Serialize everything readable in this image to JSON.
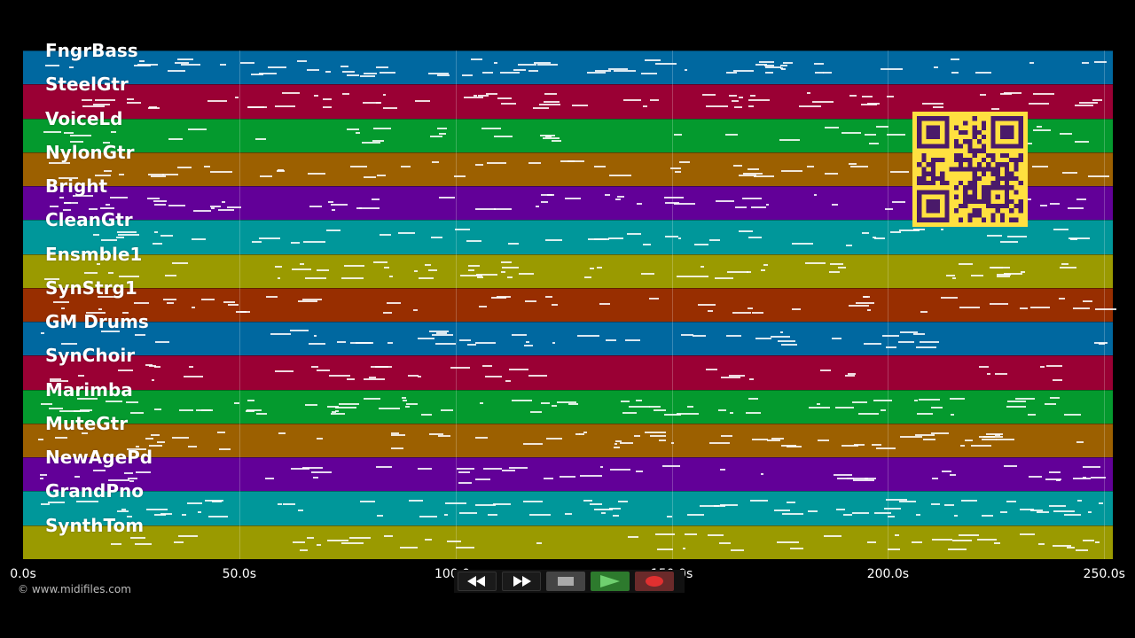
{
  "tracks": [
    {
      "name": "FngrBass",
      "color": "#0068a0"
    },
    {
      "name": "SteelGtr",
      "color": "#9a0034"
    },
    {
      "name": "VoiceLd",
      "color": "#049a2e"
    },
    {
      "name": "NylonGtr",
      "color": "#9c6000"
    },
    {
      "name": "Bright",
      "color": "#620098"
    },
    {
      "name": "CleanGtr",
      "color": "#00979a"
    },
    {
      "name": "Ensmble1",
      "color": "#9a9a00"
    },
    {
      "name": "SynStrg1",
      "color": "#982e00"
    },
    {
      "name": "GM Drums",
      "color": "#0068a0"
    },
    {
      "name": "SynChoir",
      "color": "#9a0034"
    },
    {
      "name": "Marimba",
      "color": "#049a2e"
    },
    {
      "name": "MuteGtr",
      "color": "#9c6000"
    },
    {
      "name": "NewAgePd",
      "color": "#620098"
    },
    {
      "name": "GrandPno",
      "color": "#00979a"
    },
    {
      "name": "SynthTom",
      "color": "#9a9a00"
    }
  ],
  "timeline": {
    "max_seconds": 252,
    "ticks": [
      {
        "value": 0,
        "label": "0.0s"
      },
      {
        "value": 50,
        "label": "50.0s"
      },
      {
        "value": 100,
        "label": "100.0s"
      },
      {
        "value": 150,
        "label": "150.0s"
      },
      {
        "value": 200,
        "label": "200.0s"
      },
      {
        "value": 250,
        "label": "250.0s"
      }
    ]
  },
  "footer": {
    "copyright": "© www.midifiles.com"
  },
  "controls": {
    "rewind_icon": "rewind-icon",
    "forward_icon": "fast-forward-icon",
    "stop_icon": "stop-icon",
    "play_icon": "play-icon",
    "record_icon": "record-icon"
  },
  "colors": {
    "background": "#000000",
    "qr_foreground": "#4a1a6a",
    "qr_background": "#ffe040"
  }
}
